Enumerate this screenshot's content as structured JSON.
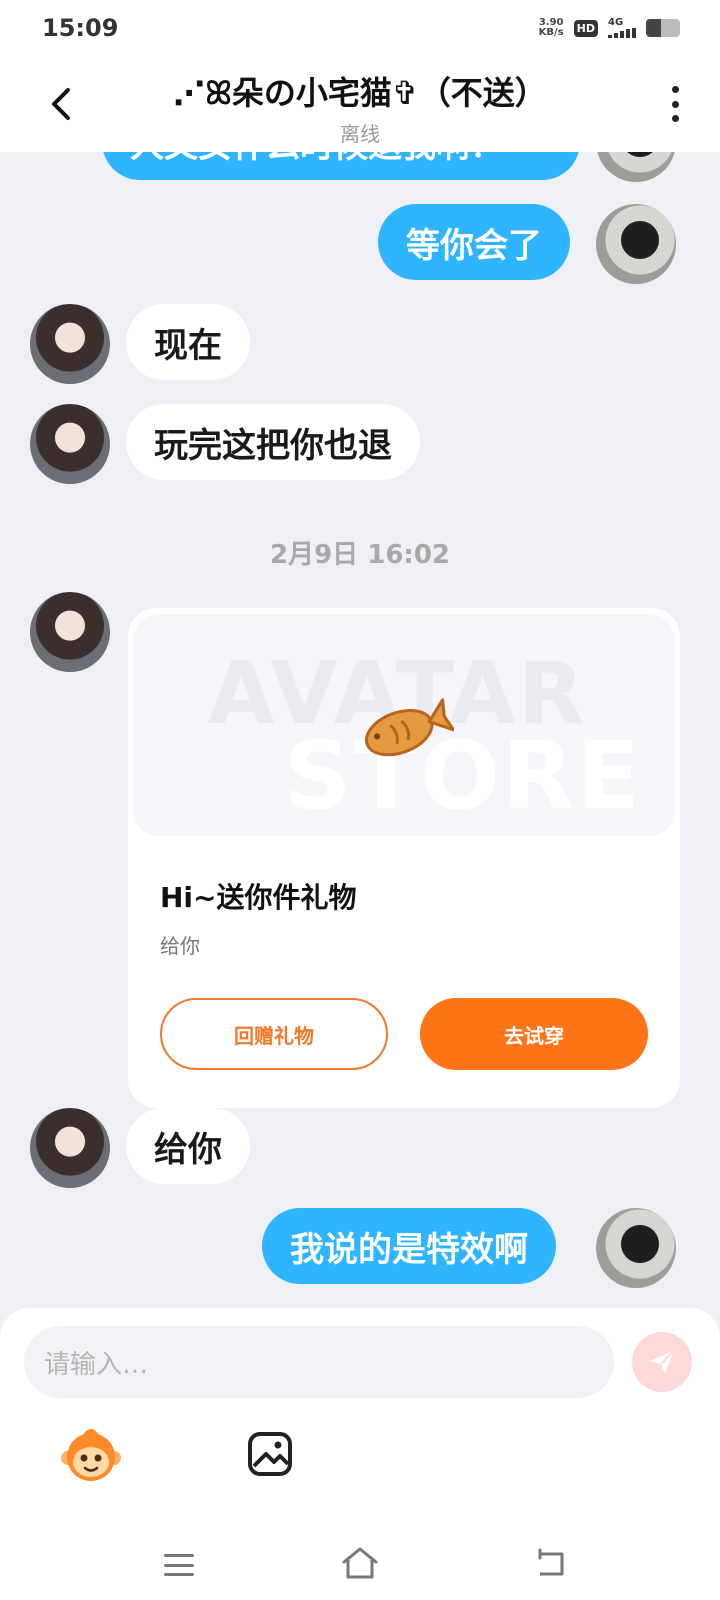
{
  "status_bar": {
    "time": "15:09",
    "net_speed_value": "3.90",
    "net_speed_unit": "KB/s",
    "hd_label": "HD",
    "network_label": "4G",
    "battery_level": 0.45
  },
  "header": {
    "title": "⋰ꕤ朵の小宅猫✞（不送）",
    "status": "离线"
  },
  "messages": [
    {
      "side": "out",
      "text": "人又女什么时候退我啊？"
    },
    {
      "side": "out",
      "text": "等你会了"
    },
    {
      "side": "in",
      "text": "现在"
    },
    {
      "side": "in",
      "text": "玩完这把你也退"
    },
    {
      "side": "in",
      "text": "给你"
    },
    {
      "side": "out",
      "text": "我说的是特效啊"
    }
  ],
  "time_divider": "2月9日 16:02",
  "gift_card": {
    "banner_line1": "AVATAR",
    "banner_line2": "STORE",
    "title": "Hi~送你件礼物",
    "subtitle": "给你",
    "return_gift_label": "回赠礼物",
    "try_on_label": "去试穿"
  },
  "input": {
    "placeholder": "请输入…"
  },
  "icons": {
    "back": "chevron-left-icon",
    "more": "more-vertical-icon",
    "send": "send-icon",
    "emoji": "monkey-emoji-icon",
    "image": "image-icon",
    "fish": "fish-cookie-icon"
  },
  "colors": {
    "outgoing_bubble": "#2fb4ff",
    "accent_orange": "#ff7417",
    "background": "#eef0f5"
  }
}
